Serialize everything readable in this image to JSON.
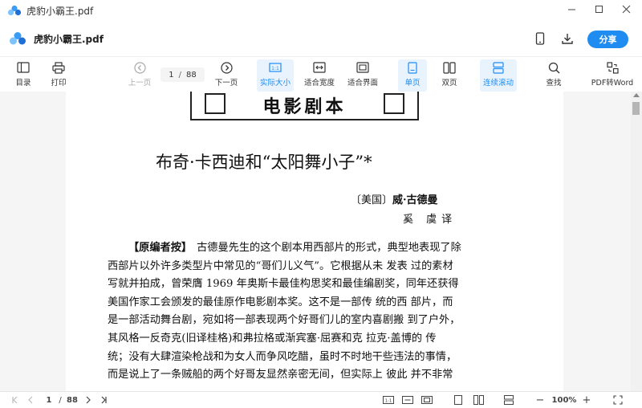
{
  "window": {
    "title": "虎豹小霸王.pdf",
    "controls": [
      "minimize-icon",
      "maximize-icon",
      "close-icon"
    ]
  },
  "header": {
    "file_name": "虎豹小霸王.pdf",
    "share_label": "分享",
    "icons": [
      "mobile-icon",
      "download-icon"
    ]
  },
  "toolbar": {
    "toc_label": "目录",
    "print_label": "打印",
    "prev_label": "上一页",
    "next_label": "下一页",
    "actual_size_label": "实际大小",
    "fit_width_label": "适合宽度",
    "fit_page_label": "适合界面",
    "single_label": "单页",
    "double_label": "双页",
    "continuous_label": "连续滚动",
    "search_label": "查找",
    "pdf2word_label": "PDF转Word"
  },
  "page_nav": {
    "current": "1",
    "separator": "/",
    "total": "88"
  },
  "document": {
    "banner": "电影剧本",
    "title": "布奇·卡西迪和“太阳舞小子”*",
    "author_prefix": "〔美国〕",
    "author_name": "威·古德曼",
    "translator": "奚 虞译",
    "lead": "【原编者按】",
    "lines": [
      "古德曼先生的这个剧本用西部片的形式，典型地表现了除",
      "西部片以外许多类型片中常见的“哥们儿义气”。它根据从未 发表 过的素材",
      "写就并拍成，曾荣膺 1969 年奥斯卡最佳构思奖和最佳编剧奖，同年还获得",
      "美国作家工会颁发的最佳原作电影剧本奖。这不是一部传 统的西 部片，而",
      "是一部活动舞台剧，宛如将一部表现两个好哥们儿的室内喜剧搬 到了户外，",
      "其风格一反奇克(旧译桂格)和弗拉格或渐宾塞·屈赛和克 拉克·盖博的 传",
      "统；没有大肆渲染枪战和为女人而争风吃醋，虽时不时地干些违法的事情，",
      "而是说上了一条贼船的两个好哥友显然亲密无间，但实际上 彼此 并不非常"
    ]
  },
  "bottom": {
    "page_current": "1",
    "page_total": "88",
    "zoom": "100%"
  },
  "colors": {
    "accent": "#1f8cf2",
    "active_bg": "#e9f3fe"
  }
}
